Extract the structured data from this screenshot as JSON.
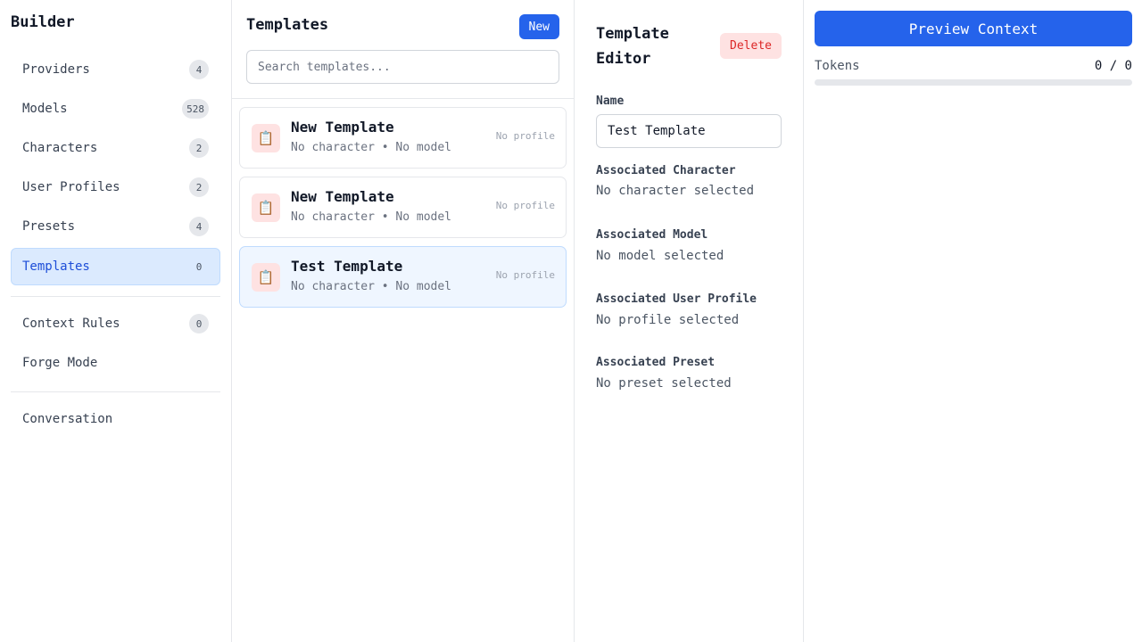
{
  "sidebar": {
    "title": "Builder",
    "items": [
      {
        "label": "Providers",
        "count": "4"
      },
      {
        "label": "Models",
        "count": "528"
      },
      {
        "label": "Characters",
        "count": "2"
      },
      {
        "label": "User Profiles",
        "count": "2"
      },
      {
        "label": "Presets",
        "count": "4"
      },
      {
        "label": "Templates",
        "count": "0",
        "active": true
      }
    ],
    "secondary": [
      {
        "label": "Context Rules",
        "count": "0"
      },
      {
        "label": "Forge Mode"
      }
    ],
    "tertiary": [
      {
        "label": "Conversation"
      }
    ]
  },
  "list": {
    "title": "Templates",
    "new_label": "New",
    "search_placeholder": "Search templates...",
    "cards": [
      {
        "icon": "clipboard-icon",
        "glyph": "📋",
        "title": "New Template",
        "subtitle": "No character • No model",
        "profile": "No profile"
      },
      {
        "icon": "clipboard-icon",
        "glyph": "📋",
        "title": "New Template",
        "subtitle": "No character • No model",
        "profile": "No profile"
      },
      {
        "icon": "clipboard-icon",
        "glyph": "📋",
        "title": "Test Template",
        "subtitle": "No character • No model",
        "profile": "No profile",
        "selected": true
      }
    ]
  },
  "editor": {
    "title": "Template Editor",
    "delete_label": "Delete",
    "name_label": "Name",
    "name_value": "Test Template",
    "character_label": "Associated Character",
    "character_value": "No character selected",
    "model_label": "Associated Model",
    "model_value": "No model selected",
    "profile_label": "Associated User Profile",
    "profile_value": "No profile selected",
    "preset_label": "Associated Preset",
    "preset_value": "No preset selected"
  },
  "preview": {
    "button_label": "Preview Context",
    "tokens_label": "Tokens",
    "tokens_value": "0 / 0",
    "progress_fraction": 0
  },
  "colors": {
    "accent": "#2563eb",
    "danger": "#dc2626",
    "danger_bg": "#fee2e2",
    "active_bg": "#dbeafe"
  }
}
